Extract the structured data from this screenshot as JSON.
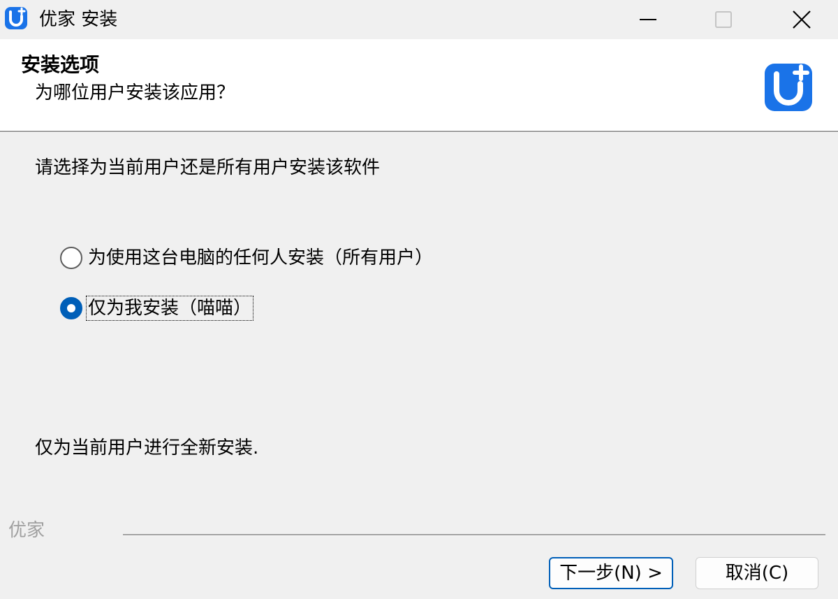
{
  "window": {
    "title": "优家 安装"
  },
  "header": {
    "title": "安装选项",
    "subtitle": "为哪位用户安装该应用？"
  },
  "body": {
    "prompt": "请选择为当前用户还是所有用户安装该软件",
    "options": [
      {
        "label": "为使用这台电脑的任何人安装（所有用户）",
        "selected": false
      },
      {
        "label": "仅为我安装（喵喵）",
        "selected": true
      }
    ],
    "description": "仅为当前用户进行全新安装."
  },
  "footer": {
    "brand": "优家",
    "next_label": "下一步(N) >",
    "cancel_label": "取消(C)"
  },
  "colors": {
    "accent": "#005fb8",
    "brand_blue": "#1a73e8"
  },
  "icons": {
    "app": "uplus-logo-icon",
    "minimize": "minimize-icon",
    "maximize": "maximize-icon",
    "close": "close-icon"
  }
}
